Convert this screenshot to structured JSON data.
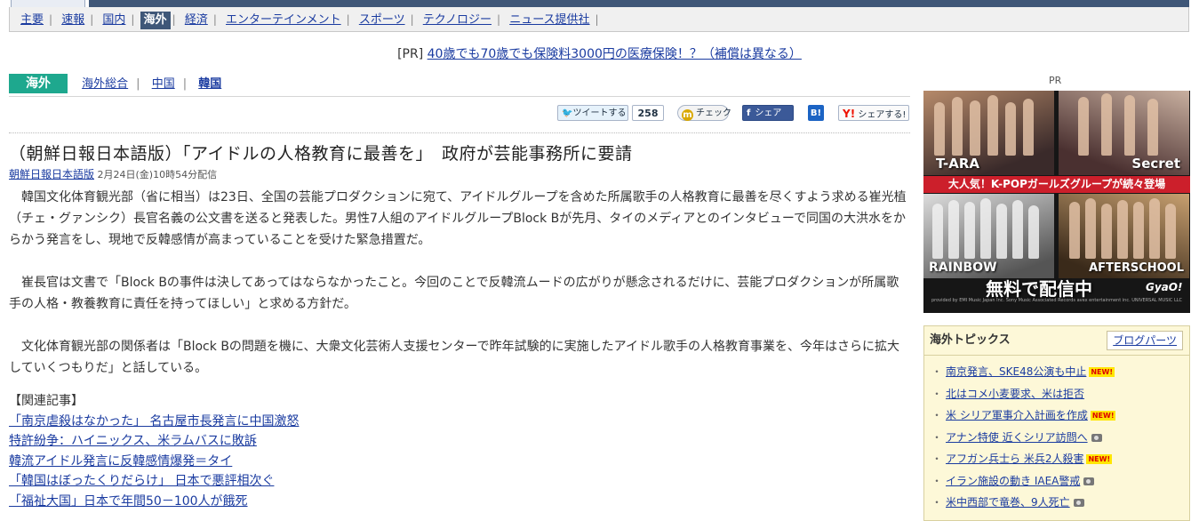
{
  "nav": {
    "items": [
      {
        "label": "主要"
      },
      {
        "label": "速報"
      },
      {
        "label": "国内"
      },
      {
        "label": "海外",
        "active": true
      },
      {
        "label": "経済"
      },
      {
        "label": "エンターテインメント"
      },
      {
        "label": "スポーツ"
      },
      {
        "label": "テクノロジー"
      },
      {
        "label": "ニュース提供社"
      }
    ]
  },
  "pr_ad": {
    "label": "[PR]",
    "text": "40歳でも70歳でも保険料3000円の医療保険！？（補償は異なる）"
  },
  "category": {
    "badge": "海外",
    "links": [
      "海外総合",
      "中国",
      "韓国"
    ]
  },
  "share": {
    "tweet_label": "ツイートする",
    "tweet_count": "258",
    "mixi_label": "チェック",
    "facebook_label": "シェア",
    "hatena_label": "B!",
    "yahoo_label": "シェアする!"
  },
  "article": {
    "title": "（朝鮮日報日本語版）「アイドルの人格教育に最善を」　政府が芸能事務所に要請",
    "source": "朝鮮日報日本語版",
    "date": "2月24日(金)10時54分配信",
    "paragraphs": [
      "韓国文化体育観光部（省に相当）は23日、全国の芸能プロダクションに宛て、アイドルグループを含めた所属歌手の人格教育に最善を尽くすよう求める崔光植（チェ・グァンシク）長官名義の公文書を送ると発表した。男性7人組のアイドルグループBlock Bが先月、タイのメディアとのインタビューで同国の大洪水をからかう発言をし、現地で反韓感情が高まっていることを受けた緊急措置だ。",
      "崔長官は文書で「Block Bの事件は決してあってはならなかったこと。今回のことで反韓流ムードの広がりが懸念されるだけに、芸能プロダクションが所属歌手の人格・教養教育に責任を持ってほしい」と求める方針だ。",
      "文化体育観光部の関係者は「Block Bの問題を機に、大衆文化芸術人支援センターで昨年試験的に実施したアイドル歌手の人格教育事業を、今年はさらに拡大していくつもりだ」と話している。"
    ]
  },
  "related": {
    "heading": "【関連記事】",
    "links": [
      "「南京虐殺はなかった」 名古屋市長発言に中国激怒",
      "特許紛争：ハイニックス、米ラムバスに敗訴",
      "韓流アイドル発言に反韓感情爆発＝タイ",
      "「韓国はぼったくりだらけ」 日本で悪評相次ぐ",
      "「福祉大国」日本で年間50－100人が餓死"
    ]
  },
  "sidebar": {
    "pr_label": "PR",
    "banner": {
      "groups": [
        "T-ARA",
        "Secret",
        "RAINBOW",
        "AFTERSCHOOL"
      ],
      "tagline": "大人気！K-POPガールズグループが続々登場",
      "free": "無料で配信中",
      "brand": "GyaO!",
      "credit": "provided by EMI Music Japan Inc. Sony Music Associated Records avex entertainment inc. UNIVERSAL MUSIC LLC"
    },
    "topics": {
      "title": "海外トピックス",
      "blogparts": "ブログパーツ",
      "new_badge": "NEW!",
      "items": [
        {
          "text": "南京発言、SKE48公演も中止",
          "badge": "new"
        },
        {
          "text": "北はコメ小麦要求、米は拒否",
          "badge": ""
        },
        {
          "text": "米 シリア軍事介入計画を作成",
          "badge": "new"
        },
        {
          "text": "アナン特使 近くシリア訪問へ",
          "badge": "camera"
        },
        {
          "text": "アフガン兵士ら 米兵2人殺害",
          "badge": "new"
        },
        {
          "text": "イラン施設の動き IAEA警戒",
          "badge": "camera"
        },
        {
          "text": "米中西部で竜巻、9人死亡",
          "badge": "camera"
        }
      ]
    }
  }
}
